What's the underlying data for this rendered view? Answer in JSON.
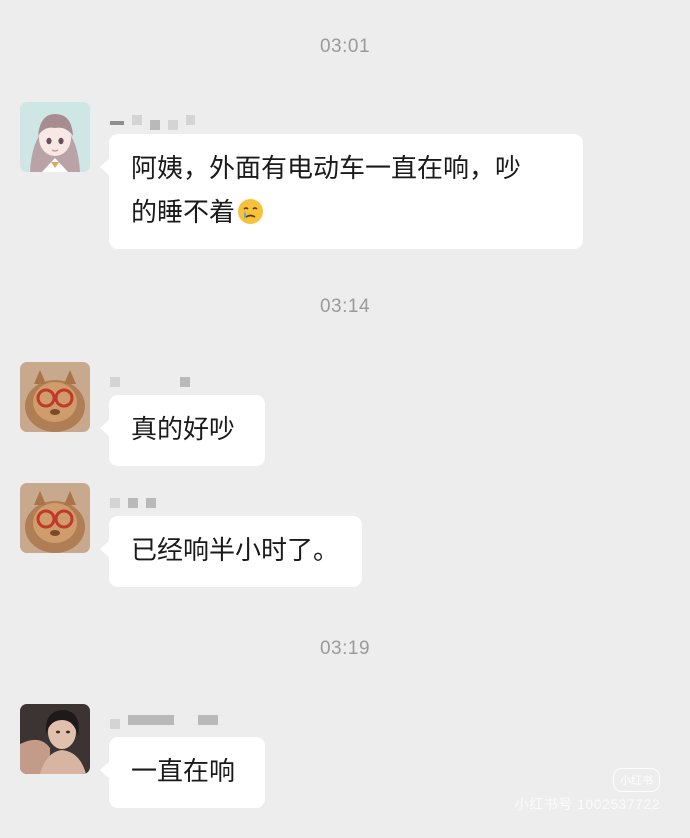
{
  "timestamps": [
    "03:01",
    "03:14",
    "03:19"
  ],
  "messages": [
    {
      "text": "阿姨，外面有电动车一直在响，吵",
      "text2": "的睡不着",
      "emoji": "crying-face-emoji"
    },
    {
      "text": "真的好吵"
    },
    {
      "text": "已经响半小时了。"
    },
    {
      "text": "一直在响"
    }
  ],
  "watermark": {
    "logo": "小红书",
    "id": "小红书号 1002537722"
  }
}
